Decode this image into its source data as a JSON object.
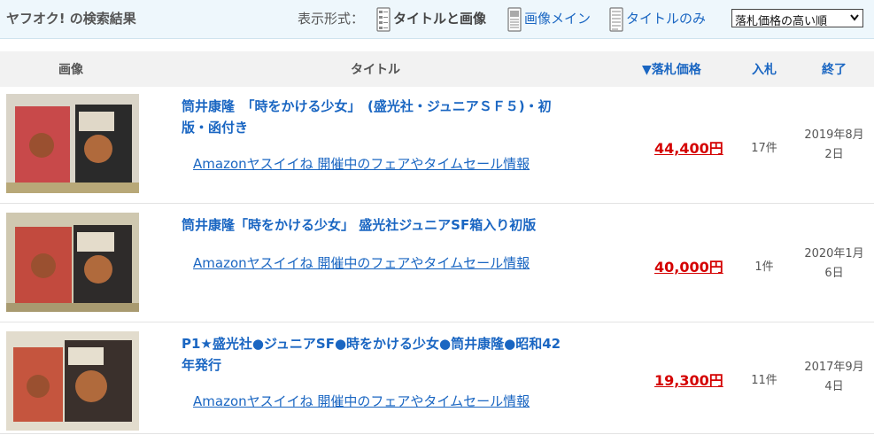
{
  "header": {
    "title": "ヤフオク! の検索結果",
    "view_label": "表示形式：",
    "view_options": [
      {
        "label": "タイトルと画像",
        "active": true,
        "icon": "list-view-icon"
      },
      {
        "label": "画像メイン",
        "active": false,
        "icon": "image-view-icon"
      },
      {
        "label": "タイトルのみ",
        "active": false,
        "icon": "text-view-icon"
      }
    ],
    "sort": {
      "selected": "落札価格の高い順"
    }
  },
  "columns": {
    "image": "画像",
    "title": "タイトル",
    "price": "▼落札価格",
    "bids": "入札",
    "end": "終了"
  },
  "colors": {
    "link": "#1a66c2",
    "price": "#d40000",
    "header_bg": "#eef7fc"
  },
  "items": [
    {
      "title_lines": [
        "筒井康隆　「時をかける少女」　(盛光社・ジュニアＳＦ５)・初",
        "版・函付き"
      ],
      "promo": "Amazonヤスイイね 開催中のフェアやタイムセール情報",
      "price": "44,400円",
      "bids": "17件",
      "end_lines": [
        "2019年8月",
        "2日"
      ]
    },
    {
      "title_lines": [
        "筒井康隆「時をかける少女」 盛光社ジュニアSF箱入り初版"
      ],
      "promo": "Amazonヤスイイね 開催中のフェアやタイムセール情報",
      "price": "40,000円",
      "bids": "1件",
      "end_lines": [
        "2020年1月",
        "6日"
      ]
    },
    {
      "title_lines": [
        "P1★盛光社●ジュニアSF●時をかける少女●筒井康隆●昭和42",
        "年発行"
      ],
      "promo": "Amazonヤスイイね 開催中のフェアやタイムセール情報",
      "price": "19,300円",
      "bids": "11件",
      "end_lines": [
        "2017年9月",
        "4日"
      ]
    }
  ]
}
